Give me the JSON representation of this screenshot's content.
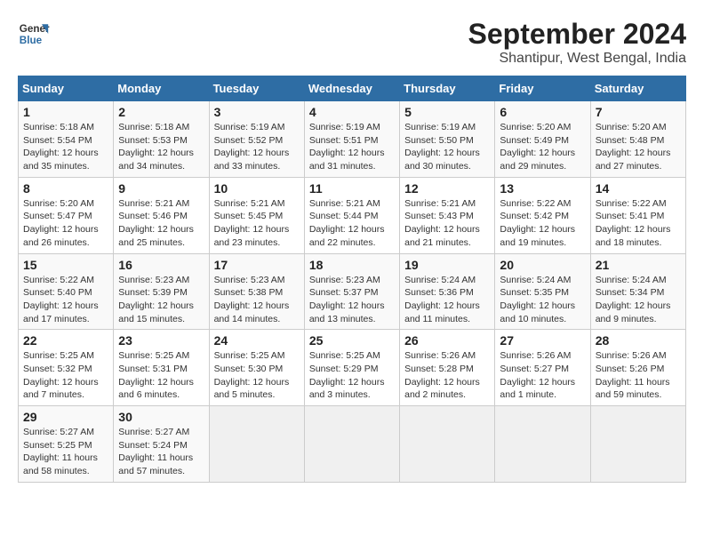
{
  "header": {
    "logo_line1": "General",
    "logo_line2": "Blue",
    "month_title": "September 2024",
    "location": "Shantipur, West Bengal, India"
  },
  "weekdays": [
    "Sunday",
    "Monday",
    "Tuesday",
    "Wednesday",
    "Thursday",
    "Friday",
    "Saturday"
  ],
  "weeks": [
    [
      {
        "day": "1",
        "info": "Sunrise: 5:18 AM\nSunset: 5:54 PM\nDaylight: 12 hours\nand 35 minutes."
      },
      {
        "day": "2",
        "info": "Sunrise: 5:18 AM\nSunset: 5:53 PM\nDaylight: 12 hours\nand 34 minutes."
      },
      {
        "day": "3",
        "info": "Sunrise: 5:19 AM\nSunset: 5:52 PM\nDaylight: 12 hours\nand 33 minutes."
      },
      {
        "day": "4",
        "info": "Sunrise: 5:19 AM\nSunset: 5:51 PM\nDaylight: 12 hours\nand 31 minutes."
      },
      {
        "day": "5",
        "info": "Sunrise: 5:19 AM\nSunset: 5:50 PM\nDaylight: 12 hours\nand 30 minutes."
      },
      {
        "day": "6",
        "info": "Sunrise: 5:20 AM\nSunset: 5:49 PM\nDaylight: 12 hours\nand 29 minutes."
      },
      {
        "day": "7",
        "info": "Sunrise: 5:20 AM\nSunset: 5:48 PM\nDaylight: 12 hours\nand 27 minutes."
      }
    ],
    [
      {
        "day": "8",
        "info": "Sunrise: 5:20 AM\nSunset: 5:47 PM\nDaylight: 12 hours\nand 26 minutes."
      },
      {
        "day": "9",
        "info": "Sunrise: 5:21 AM\nSunset: 5:46 PM\nDaylight: 12 hours\nand 25 minutes."
      },
      {
        "day": "10",
        "info": "Sunrise: 5:21 AM\nSunset: 5:45 PM\nDaylight: 12 hours\nand 23 minutes."
      },
      {
        "day": "11",
        "info": "Sunrise: 5:21 AM\nSunset: 5:44 PM\nDaylight: 12 hours\nand 22 minutes."
      },
      {
        "day": "12",
        "info": "Sunrise: 5:21 AM\nSunset: 5:43 PM\nDaylight: 12 hours\nand 21 minutes."
      },
      {
        "day": "13",
        "info": "Sunrise: 5:22 AM\nSunset: 5:42 PM\nDaylight: 12 hours\nand 19 minutes."
      },
      {
        "day": "14",
        "info": "Sunrise: 5:22 AM\nSunset: 5:41 PM\nDaylight: 12 hours\nand 18 minutes."
      }
    ],
    [
      {
        "day": "15",
        "info": "Sunrise: 5:22 AM\nSunset: 5:40 PM\nDaylight: 12 hours\nand 17 minutes."
      },
      {
        "day": "16",
        "info": "Sunrise: 5:23 AM\nSunset: 5:39 PM\nDaylight: 12 hours\nand 15 minutes."
      },
      {
        "day": "17",
        "info": "Sunrise: 5:23 AM\nSunset: 5:38 PM\nDaylight: 12 hours\nand 14 minutes."
      },
      {
        "day": "18",
        "info": "Sunrise: 5:23 AM\nSunset: 5:37 PM\nDaylight: 12 hours\nand 13 minutes."
      },
      {
        "day": "19",
        "info": "Sunrise: 5:24 AM\nSunset: 5:36 PM\nDaylight: 12 hours\nand 11 minutes."
      },
      {
        "day": "20",
        "info": "Sunrise: 5:24 AM\nSunset: 5:35 PM\nDaylight: 12 hours\nand 10 minutes."
      },
      {
        "day": "21",
        "info": "Sunrise: 5:24 AM\nSunset: 5:34 PM\nDaylight: 12 hours\nand 9 minutes."
      }
    ],
    [
      {
        "day": "22",
        "info": "Sunrise: 5:25 AM\nSunset: 5:32 PM\nDaylight: 12 hours\nand 7 minutes."
      },
      {
        "day": "23",
        "info": "Sunrise: 5:25 AM\nSunset: 5:31 PM\nDaylight: 12 hours\nand 6 minutes."
      },
      {
        "day": "24",
        "info": "Sunrise: 5:25 AM\nSunset: 5:30 PM\nDaylight: 12 hours\nand 5 minutes."
      },
      {
        "day": "25",
        "info": "Sunrise: 5:25 AM\nSunset: 5:29 PM\nDaylight: 12 hours\nand 3 minutes."
      },
      {
        "day": "26",
        "info": "Sunrise: 5:26 AM\nSunset: 5:28 PM\nDaylight: 12 hours\nand 2 minutes."
      },
      {
        "day": "27",
        "info": "Sunrise: 5:26 AM\nSunset: 5:27 PM\nDaylight: 12 hours\nand 1 minute."
      },
      {
        "day": "28",
        "info": "Sunrise: 5:26 AM\nSunset: 5:26 PM\nDaylight: 11 hours\nand 59 minutes."
      }
    ],
    [
      {
        "day": "29",
        "info": "Sunrise: 5:27 AM\nSunset: 5:25 PM\nDaylight: 11 hours\nand 58 minutes."
      },
      {
        "day": "30",
        "info": "Sunrise: 5:27 AM\nSunset: 5:24 PM\nDaylight: 11 hours\nand 57 minutes."
      },
      {
        "day": "",
        "info": ""
      },
      {
        "day": "",
        "info": ""
      },
      {
        "day": "",
        "info": ""
      },
      {
        "day": "",
        "info": ""
      },
      {
        "day": "",
        "info": ""
      }
    ]
  ]
}
